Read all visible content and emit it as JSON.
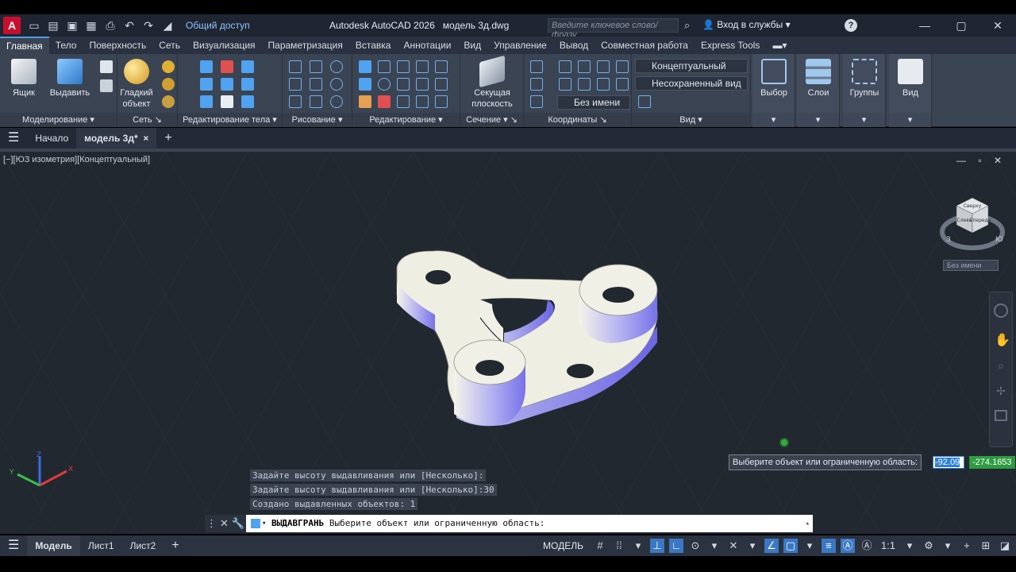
{
  "window": {
    "app_logo": "A",
    "share_label": "Общий доступ",
    "title": "Autodesk AutoCAD 2026",
    "filename": "модель 3д.dwg",
    "search_placeholder": "Введите ключевое слово/фразу",
    "login": "Вход в службы",
    "help_icon": "?"
  },
  "ribbon_tabs": [
    "Главная",
    "Тело",
    "Поверхность",
    "Сеть",
    "Визуализация",
    "Параметризация",
    "Вставка",
    "Аннотации",
    "Вид",
    "Управление",
    "Вывод",
    "Совместная работа",
    "Express Tools"
  ],
  "ribbon": {
    "modeling_title": "Моделирование",
    "box_label": "Ящик",
    "extrude_label": "Выдавить",
    "mesh_title": "Сеть",
    "smooth_label1": "Гладкий",
    "smooth_label2": "объект",
    "solid_edit_title": "Редактирование тела",
    "draw_title": "Рисование",
    "edit_title": "Редактирование",
    "section_title": "Сечение",
    "section_plane1": "Секущая",
    "section_plane2": "плоскость",
    "coords_title": "Координаты",
    "ucs_dd": "Без имени",
    "view_title": "Вид",
    "visual_style": "Концептуальный",
    "saved_view": "Несохраненный вид",
    "select_label": "Выбор",
    "layers_label": "Слои",
    "groups_label": "Группы",
    "view_label": "Вид"
  },
  "doc_tabs": {
    "start": "Начало",
    "active": "модель 3д*",
    "close": "×",
    "plus": "+"
  },
  "viewport": {
    "label": "[−][ЮЗ изометрия][Концептуальный]",
    "controls": "— ▫ ✕",
    "viewcube_wcs": "Без имени",
    "viewcube_top": "Сверху",
    "viewcube_left": "Слева",
    "viewcube_front": "Спереди",
    "compass_s": "З",
    "compass_e": "Ю",
    "axis_x": "X",
    "axis_y": "Y",
    "axis_z": "Z"
  },
  "command": {
    "history": [
      "Задайте высоту выдавливания или [Несколько]:",
      "Задайте высоту выдавливания или [Несколько]:30",
      "Создано выдавленных объектов: 1"
    ],
    "current_cmd": "ВЫДАВГРАНЬ",
    "prompt": "Выберите объект или ограниченную область:",
    "tooltip": "Выберите объект или ограниченную область:",
    "coord_x": "-92.09",
    "coord_y": "-274.1653"
  },
  "statusbar": {
    "model_tab": "Модель",
    "layout1": "Лист1",
    "layout2": "Лист2",
    "plus": "+",
    "space": "МОДЕЛЬ",
    "scale": "1:1"
  },
  "colors": {
    "accent": "#4f9de3",
    "part_face": "#efeee0",
    "part_side": "#8f8cf0",
    "coord_green": "#2e9c41"
  }
}
